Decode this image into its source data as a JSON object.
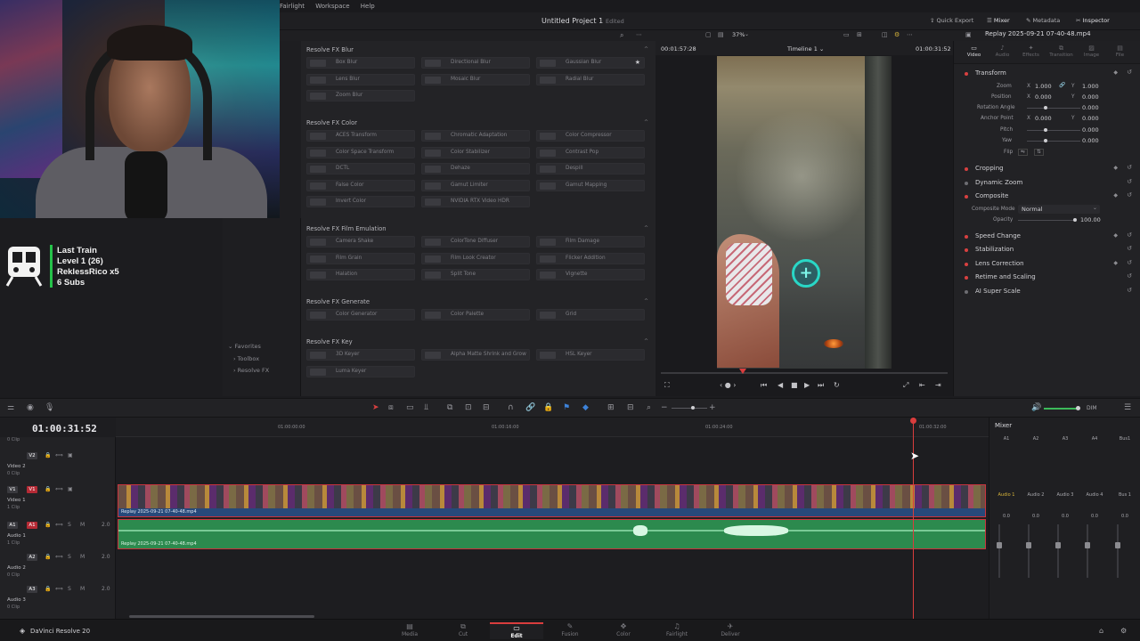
{
  "menu": [
    "Fairlight",
    "Workspace",
    "Help"
  ],
  "project": {
    "title": "Untitled Project 1",
    "status": "Edited"
  },
  "header_right": {
    "quick_export": "Quick Export",
    "mixer": "Mixer",
    "metadata": "Metadata",
    "inspector": "Inspector"
  },
  "webcam": {
    "description_hidden": ""
  },
  "overlay": {
    "line1": "Last Train",
    "line2": "Level 1  (26)",
    "line3": "ReklessRico x5",
    "line4": "6 Subs"
  },
  "fx_nav": {
    "favorites": "Favorites",
    "toolbox": "Toolbox",
    "resolve_fx": "Resolve FX"
  },
  "fx_sections": [
    {
      "title": "Resolve FX Blur",
      "items": [
        "Box Blur",
        "Directional Blur",
        "Gaussian Blur",
        "Lens Blur",
        "Mosaic Blur",
        "Radial Blur",
        "Zoom Blur"
      ]
    },
    {
      "title": "Resolve FX Color",
      "items": [
        "ACES Transform",
        "Chromatic Adaptation",
        "Color Compressor",
        "Color Space Transform",
        "Color Stabilizer",
        "Contrast Pop",
        "DCTL",
        "Dehaze",
        "Despill",
        "False Color",
        "Gamut Limiter",
        "Gamut Mapping",
        "Invert Color",
        "NVIDIA RTX Video HDR"
      ]
    },
    {
      "title": "Resolve FX Film Emulation",
      "items": [
        "Camera Shake",
        "ColorTone Diffuser",
        "Film Damage",
        "Film Grain",
        "Film Look Creator",
        "Flicker Addition",
        "Halation",
        "Split Tone",
        "Vignette"
      ]
    },
    {
      "title": "Resolve FX Generate",
      "items": [
        "Color Generator",
        "Color Palette",
        "Grid"
      ]
    },
    {
      "title": "Resolve FX Key",
      "items": [
        "3D Keyer",
        "Alpha Matte Shrink and Grow",
        "HSL Keyer",
        "Luma Keyer"
      ]
    }
  ],
  "viewer": {
    "zoom": "37%",
    "timecode_left": "00:01:57:28",
    "timeline_name": "Timeline 1",
    "timecode_right": "01:00:31:52"
  },
  "inspector": {
    "clip_name": "Replay 2025-09-21 07-40-48.mp4",
    "tabs": [
      "Video",
      "Audio",
      "Effects",
      "Transition",
      "Image",
      "File"
    ],
    "transform": {
      "title": "Transform",
      "zoom_label": "Zoom",
      "zoom_x": "1.000",
      "zoom_y": "1.000",
      "position_label": "Position",
      "pos_x": "0.000",
      "pos_y": "0.000",
      "rotation_label": "Rotation Angle",
      "rotation": "0.000",
      "anchor_label": "Anchor Point",
      "anchor_x": "0.000",
      "anchor_y": "0.000",
      "pitch_label": "Pitch",
      "pitch": "0.000",
      "yaw_label": "Yaw",
      "yaw": "0.000",
      "flip_label": "Flip",
      "x": "X",
      "y": "Y"
    },
    "sections": [
      "Cropping",
      "Dynamic Zoom",
      "Composite"
    ],
    "composite": {
      "mode_label": "Composite Mode",
      "mode": "Normal",
      "opacity_label": "Opacity",
      "opacity": "100.00"
    },
    "sections2": [
      "Speed Change",
      "Stabilization",
      "Lens Correction",
      "Retime and Scaling",
      "AI Super Scale"
    ]
  },
  "timeline": {
    "timecode": "01:00:31:52",
    "ruler": [
      "01:00:00:00",
      "01:00:16:00",
      "01:00:24:00",
      "01:00:32:00"
    ],
    "tracks": {
      "top_clip": "0 Clip",
      "v2": {
        "tag": "V2",
        "name": "Video 2",
        "sub": "0 Clip"
      },
      "v1": {
        "lead": "V1",
        "tag": "V1",
        "name": "Video 1",
        "sub": "1 Clip"
      },
      "a1": {
        "lead": "A1",
        "tag": "A1",
        "name": "Audio 1",
        "sub": "1 Clip",
        "level": "2.0"
      },
      "a2": {
        "tag": "A2",
        "name": "Audio 2",
        "sub": "0 Clip",
        "level": "2.0"
      },
      "a3": {
        "tag": "A3",
        "name": "Audio 3",
        "sub": "0 Clip",
        "level": "2.0"
      }
    },
    "video_clip": "Replay 2025-09-21 07-40-48.mp4",
    "audio_clip": "Replay 2025-09-21 07-40-48.mp4"
  },
  "mixer": {
    "title": "Mixer",
    "channels": [
      "A1",
      "A2",
      "A3",
      "A4",
      "Bus1"
    ],
    "strips": [
      "Audio 1",
      "Audio 2",
      "Audio 3",
      "Audio 4",
      "Bus 1"
    ],
    "levels": [
      "0.0",
      "0.0",
      "0.0",
      "0.0",
      "0.0"
    ]
  },
  "toolbar": {
    "dim": "DIM"
  },
  "pages": {
    "app": "DaVinci Resolve 20",
    "tabs": [
      "Media",
      "Cut",
      "Edit",
      "Fusion",
      "Color",
      "Fairlight",
      "Deliver"
    ],
    "active": "Edit"
  }
}
